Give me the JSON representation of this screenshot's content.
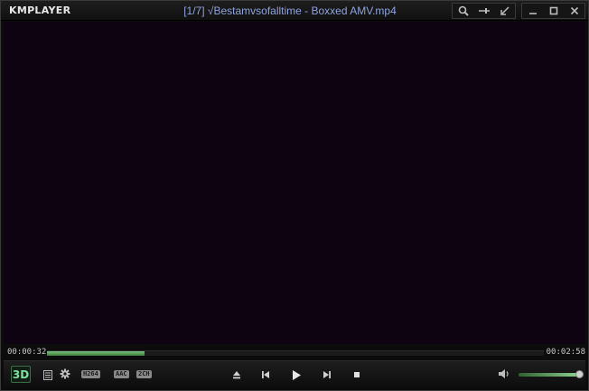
{
  "app": {
    "logo_text": "KMPLAYER"
  },
  "title_bar": {
    "title": "[1/7] √Bestamvsofalltime - Boxxed AMV.mp4",
    "buttons": [
      "search-icon",
      "pin-icon",
      "compact-icon",
      "minimize-icon",
      "maximize-icon",
      "close-icon"
    ]
  },
  "playback": {
    "current_time": "00:00:32",
    "total_time": "00:02:58",
    "progress_fraction": 0.197
  },
  "controls": {
    "three_d_label": "3D",
    "codecs": [
      "H264",
      "AAC",
      "2CH"
    ],
    "volume_fraction": 1.0
  },
  "colors": {
    "video_background": "#0e0310",
    "title_text": "#8ea2dc",
    "progress_fill": "#5fa55f"
  }
}
